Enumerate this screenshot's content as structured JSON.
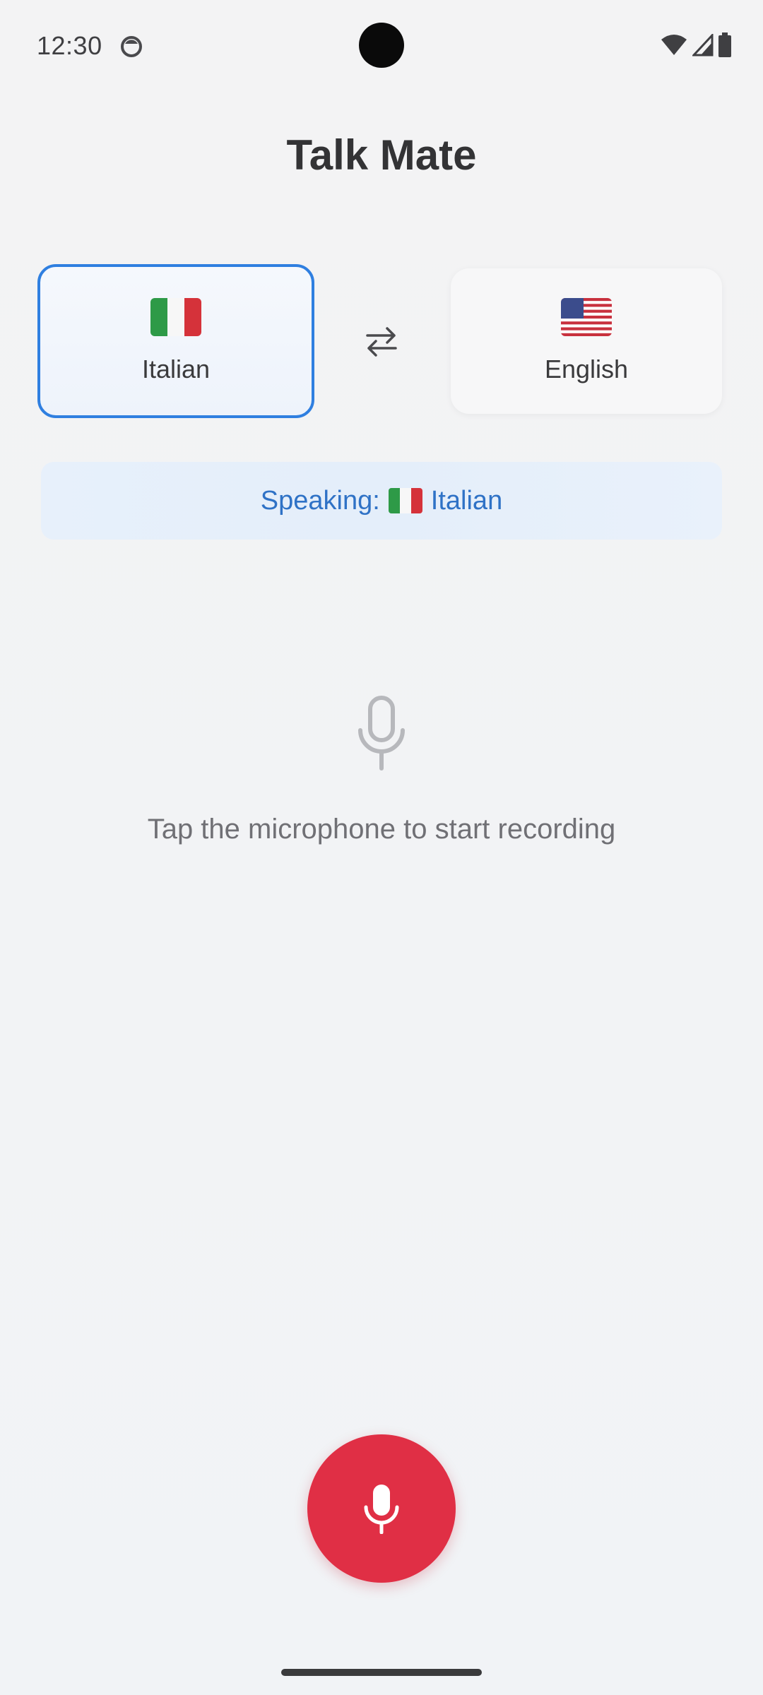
{
  "status_bar": {
    "time": "12:30",
    "icons": [
      "sync-icon",
      "wifi-icon",
      "cellular-signal-icon",
      "battery-icon"
    ]
  },
  "app": {
    "title": "Talk Mate"
  },
  "languages": {
    "source": {
      "name": "Italian",
      "flag": "italy-flag-icon",
      "selected": true
    },
    "target": {
      "name": "English",
      "flag": "usa-flag-icon",
      "selected": false
    },
    "swap_icon": "swap-arrows-icon"
  },
  "speaking_banner": {
    "prefix": "Speaking:",
    "language": "Italian",
    "flag": "italy-flag-icon"
  },
  "empty_state": {
    "icon": "microphone-icon",
    "message": "Tap the microphone to start recording"
  },
  "record_button": {
    "icon": "microphone-icon"
  },
  "colors": {
    "accent": "#2f7fe0",
    "banner_text": "#2f72c6",
    "record": "#e02f45"
  }
}
